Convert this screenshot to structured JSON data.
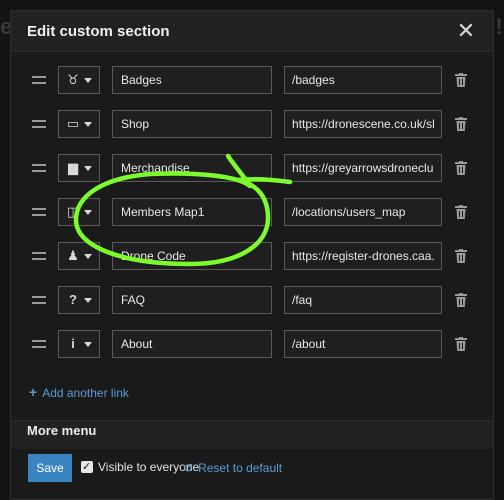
{
  "modal": {
    "title": "Edit custom section",
    "close_glyph": "✕"
  },
  "links": [
    {
      "icon": "trophy-icon",
      "icon_glyph": "♉",
      "label": "Badges",
      "url": "/badges"
    },
    {
      "icon": "shop-card-icon",
      "icon_glyph": "▭",
      "label": "Shop",
      "url": "https://dronescene.co.uk/sl"
    },
    {
      "icon": "book-icon",
      "icon_glyph": "▆",
      "label": "Merchandise",
      "url": "https://greyarrowsdroneclu"
    },
    {
      "icon": "map-icon",
      "icon_glyph": "◫",
      "label": "Members Map1",
      "url": "/locations/users_map"
    },
    {
      "icon": "reading-icon",
      "icon_glyph": "♟",
      "label": "Drone Code",
      "url": "https://register-drones.caa."
    },
    {
      "icon": "question-icon",
      "icon_glyph": "?",
      "label": "FAQ",
      "url": "/faq"
    },
    {
      "icon": "info-icon",
      "icon_glyph": "i",
      "label": "About",
      "url": "/about"
    }
  ],
  "add_link": {
    "plus": "+",
    "label": "Add another link"
  },
  "more_menu": {
    "title": "More menu"
  },
  "footer": {
    "save_label": "Save",
    "visible_label": "Visible to everyone",
    "reset_glyph": "↺",
    "reset_label": "Reset to default",
    "visible_checked": true
  },
  "colors": {
    "accent": "#3a84c2",
    "link": "#5a9bd6",
    "annotation": "#7CFC2A"
  }
}
